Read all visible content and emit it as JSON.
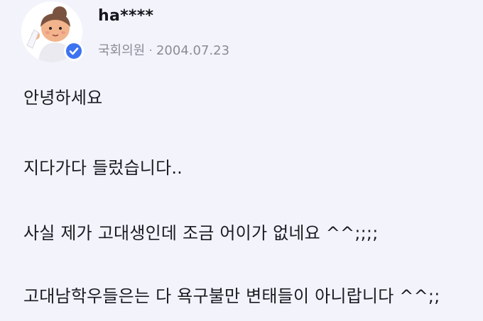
{
  "author": {
    "name": "ha****",
    "role": "국회의원",
    "separator": "·",
    "date": "2004.07.23",
    "avatar_icon": "cartoon-character-avatar",
    "badge_icon": "verified-check-icon",
    "badge_color": "#3c73f0"
  },
  "post": {
    "lines": [
      "안녕하세요",
      "지다가다 들렀습니다..",
      "사실 제가 고대생인데 조금 어이가 없네요 ^^;;;;",
      "고대남학우들은는 다 욕구불만 변태들이 아니랍니다 ^^;;"
    ]
  }
}
